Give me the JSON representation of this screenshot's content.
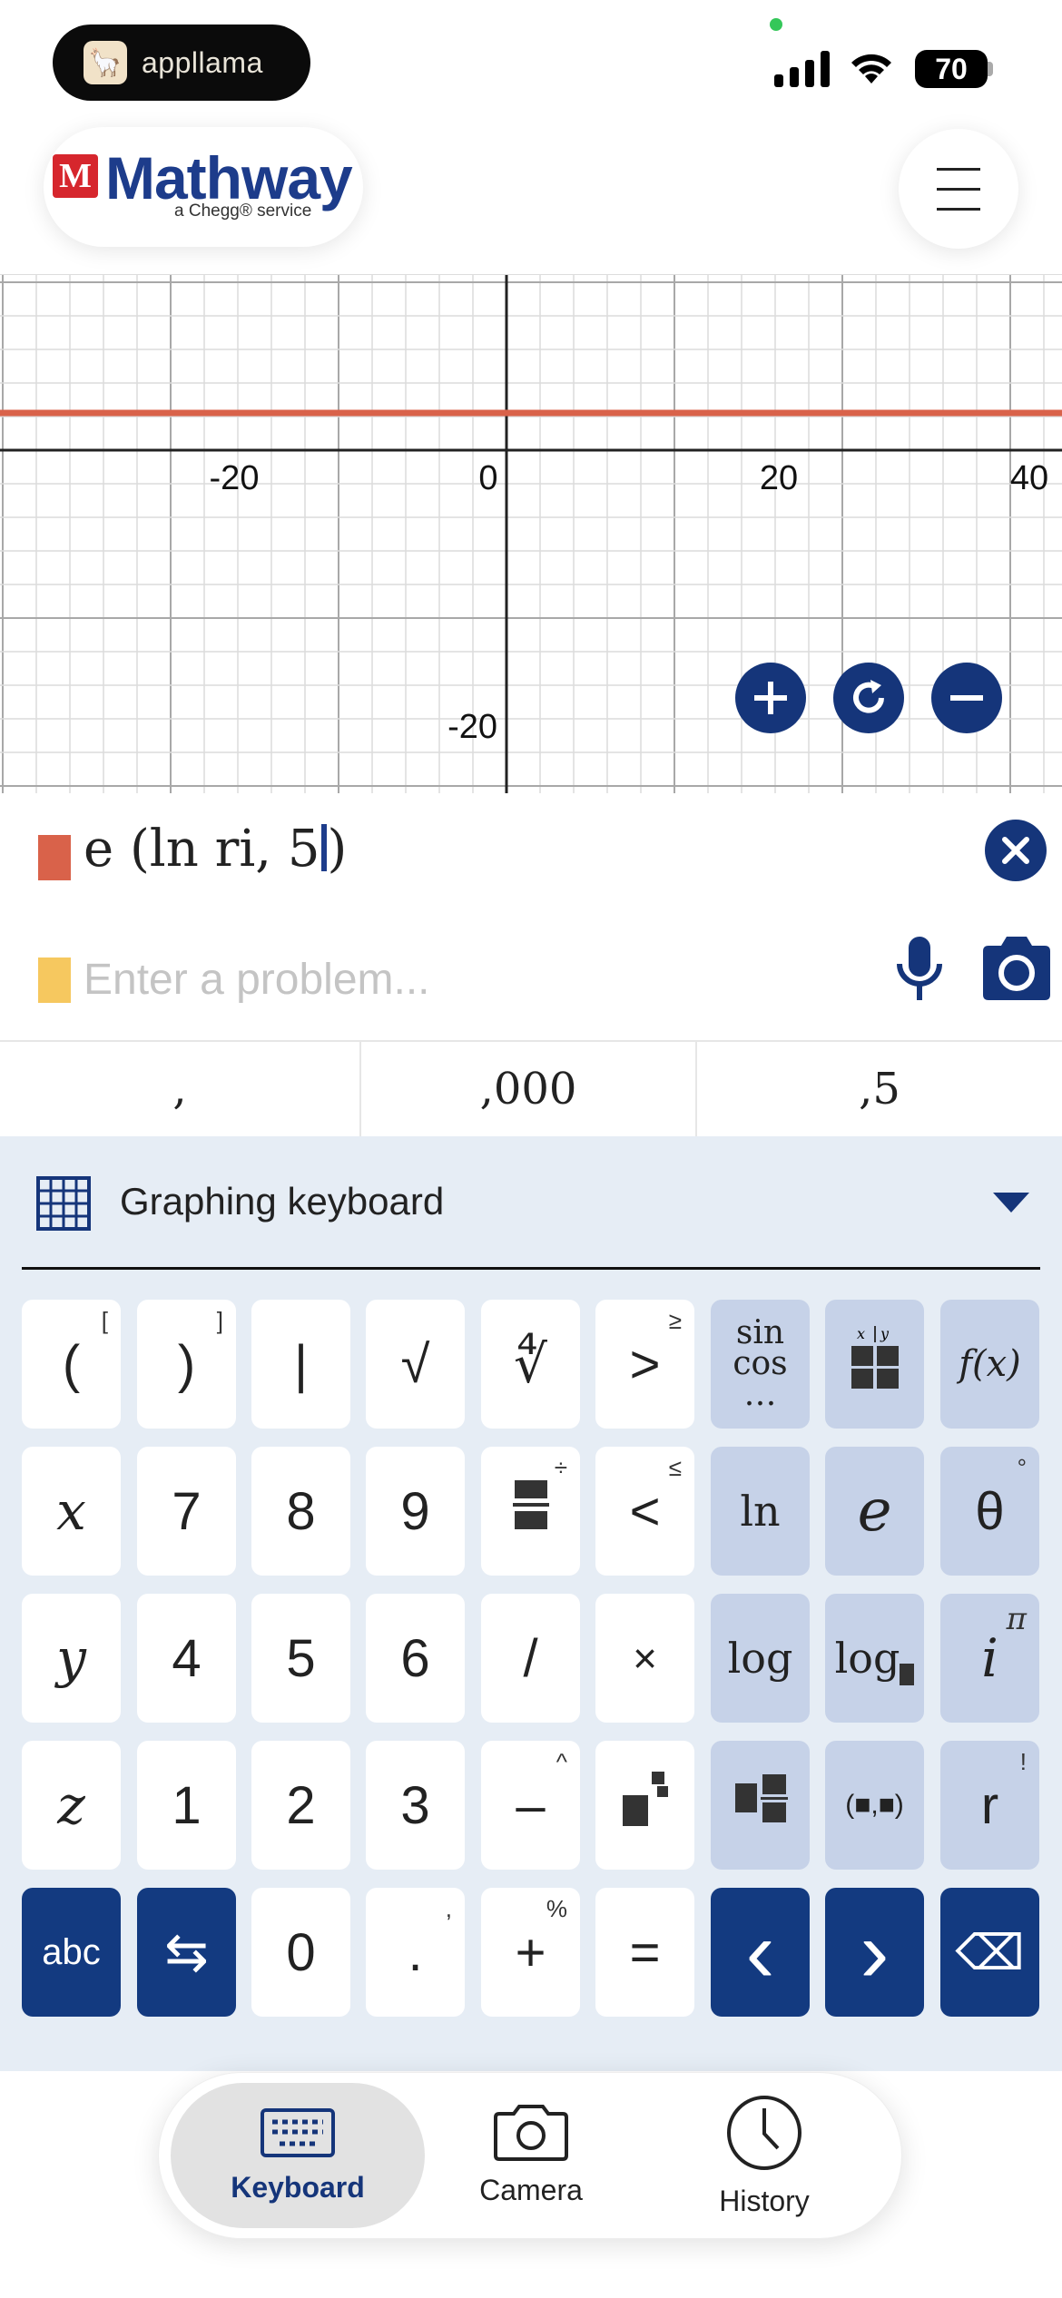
{
  "status_bar": {
    "app_pill_label": "appllama",
    "battery": "70"
  },
  "header": {
    "logo_word": "Mathway",
    "logo_sub": "a Chegg® service",
    "logo_mark": "M"
  },
  "graph": {
    "x_ticks": [
      "-20",
      "0",
      "20",
      "40"
    ],
    "y_ticks": [
      "-20"
    ],
    "line_color": "#d9624a",
    "axis_color": "#222222",
    "grid_color": "#dcdcdc"
  },
  "problem": {
    "expression": "e (ln ri, 5",
    "closing": ")",
    "swatch_color": "#d9624a"
  },
  "input": {
    "placeholder": "Enter a problem...",
    "swatch_color": "#f6c85f"
  },
  "suggestions": [
    ",",
    ",000",
    ",5"
  ],
  "keyboard": {
    "title": "Graphing keyboard",
    "rows": [
      [
        {
          "label": "(",
          "sup": "[",
          "style": "w",
          "name": "key-open-paren"
        },
        {
          "label": ")",
          "sup": "]",
          "style": "w",
          "name": "key-close-paren"
        },
        {
          "label": "|",
          "sup": "",
          "style": "w",
          "name": "key-abs"
        },
        {
          "label": "√",
          "sup": "",
          "style": "w",
          "name": "key-sqrt"
        },
        {
          "label": "∜",
          "sup": "",
          "style": "w",
          "name": "key-nth-root"
        },
        {
          "label": ">",
          "sup": "≥",
          "style": "w",
          "name": "key-greater"
        },
        {
          "label": "sin cos …",
          "sup": "",
          "style": "b",
          "name": "key-trig"
        },
        {
          "label": "x|y",
          "sup": "",
          "style": "b",
          "name": "key-table"
        },
        {
          "label": "f(x)",
          "sup": "",
          "style": "b",
          "name": "key-function"
        }
      ],
      [
        {
          "label": "x",
          "sup": "",
          "style": "w",
          "name": "key-x"
        },
        {
          "label": "7",
          "sup": "",
          "style": "w",
          "name": "key-7"
        },
        {
          "label": "8",
          "sup": "",
          "style": "w",
          "name": "key-8"
        },
        {
          "label": "9",
          "sup": "",
          "style": "w",
          "name": "key-9"
        },
        {
          "label": "fraction",
          "sup": "÷",
          "style": "w",
          "name": "key-fraction"
        },
        {
          "label": "<",
          "sup": "≤",
          "style": "w",
          "name": "key-less"
        },
        {
          "label": "ln",
          "sup": "",
          "style": "b",
          "name": "key-ln"
        },
        {
          "label": "e",
          "sup": "",
          "style": "b",
          "name": "key-e"
        },
        {
          "label": "θ",
          "sup": "°",
          "style": "b",
          "name": "key-theta"
        }
      ],
      [
        {
          "label": "y",
          "sup": "",
          "style": "w",
          "name": "key-y"
        },
        {
          "label": "4",
          "sup": "",
          "style": "w",
          "name": "key-4"
        },
        {
          "label": "5",
          "sup": "",
          "style": "w",
          "name": "key-5"
        },
        {
          "label": "6",
          "sup": "",
          "style": "w",
          "name": "key-6"
        },
        {
          "label": "/",
          "sup": "",
          "style": "w",
          "name": "key-divide"
        },
        {
          "label": "×",
          "sup": "",
          "style": "w",
          "name": "key-multiply"
        },
        {
          "label": "log",
          "sup": "",
          "style": "b",
          "name": "key-log"
        },
        {
          "label": "log",
          "sup": "",
          "style": "b",
          "name": "key-log-base"
        },
        {
          "label": "i",
          "sup": "π",
          "style": "b",
          "name": "key-i"
        }
      ],
      [
        {
          "label": "z",
          "sup": "",
          "style": "w",
          "name": "key-z"
        },
        {
          "label": "1",
          "sup": "",
          "style": "w",
          "name": "key-1"
        },
        {
          "label": "2",
          "sup": "",
          "style": "w",
          "name": "key-2"
        },
        {
          "label": "3",
          "sup": "",
          "style": "w",
          "name": "key-3"
        },
        {
          "label": "–",
          "sup": "^",
          "style": "w",
          "name": "key-minus"
        },
        {
          "label": "power",
          "sup": "",
          "style": "w",
          "name": "key-power"
        },
        {
          "label": "mixed",
          "sup": "",
          "style": "b",
          "name": "key-mixed-fraction"
        },
        {
          "label": "(■,■)",
          "sup": "",
          "style": "b",
          "name": "key-point"
        },
        {
          "label": "r",
          "sup": "!",
          "style": "b",
          "name": "key-r"
        }
      ],
      [
        {
          "label": "abc",
          "sup": "",
          "style": "d",
          "name": "key-abc"
        },
        {
          "label": "⇆",
          "sup": "",
          "style": "d",
          "name": "key-switch"
        },
        {
          "label": "0",
          "sup": "",
          "style": "w",
          "name": "key-0"
        },
        {
          "label": ".",
          "sup": ",",
          "style": "w",
          "name": "key-decimal"
        },
        {
          "label": "+",
          "sup": "%",
          "style": "w",
          "name": "key-plus"
        },
        {
          "label": "=",
          "sup": "",
          "style": "w",
          "name": "key-equals"
        },
        {
          "label": "‹",
          "sup": "",
          "style": "d",
          "name": "key-left"
        },
        {
          "label": "›",
          "sup": "",
          "style": "d",
          "name": "key-right"
        },
        {
          "label": "⌫",
          "sup": "",
          "style": "d",
          "name": "key-backspace"
        }
      ]
    ]
  },
  "tabs": [
    {
      "label": "Keyboard",
      "icon": "keyboard-icon",
      "active": true
    },
    {
      "label": "Camera",
      "icon": "camera-icon",
      "active": false
    },
    {
      "label": "History",
      "icon": "clock-icon",
      "active": false
    }
  ]
}
